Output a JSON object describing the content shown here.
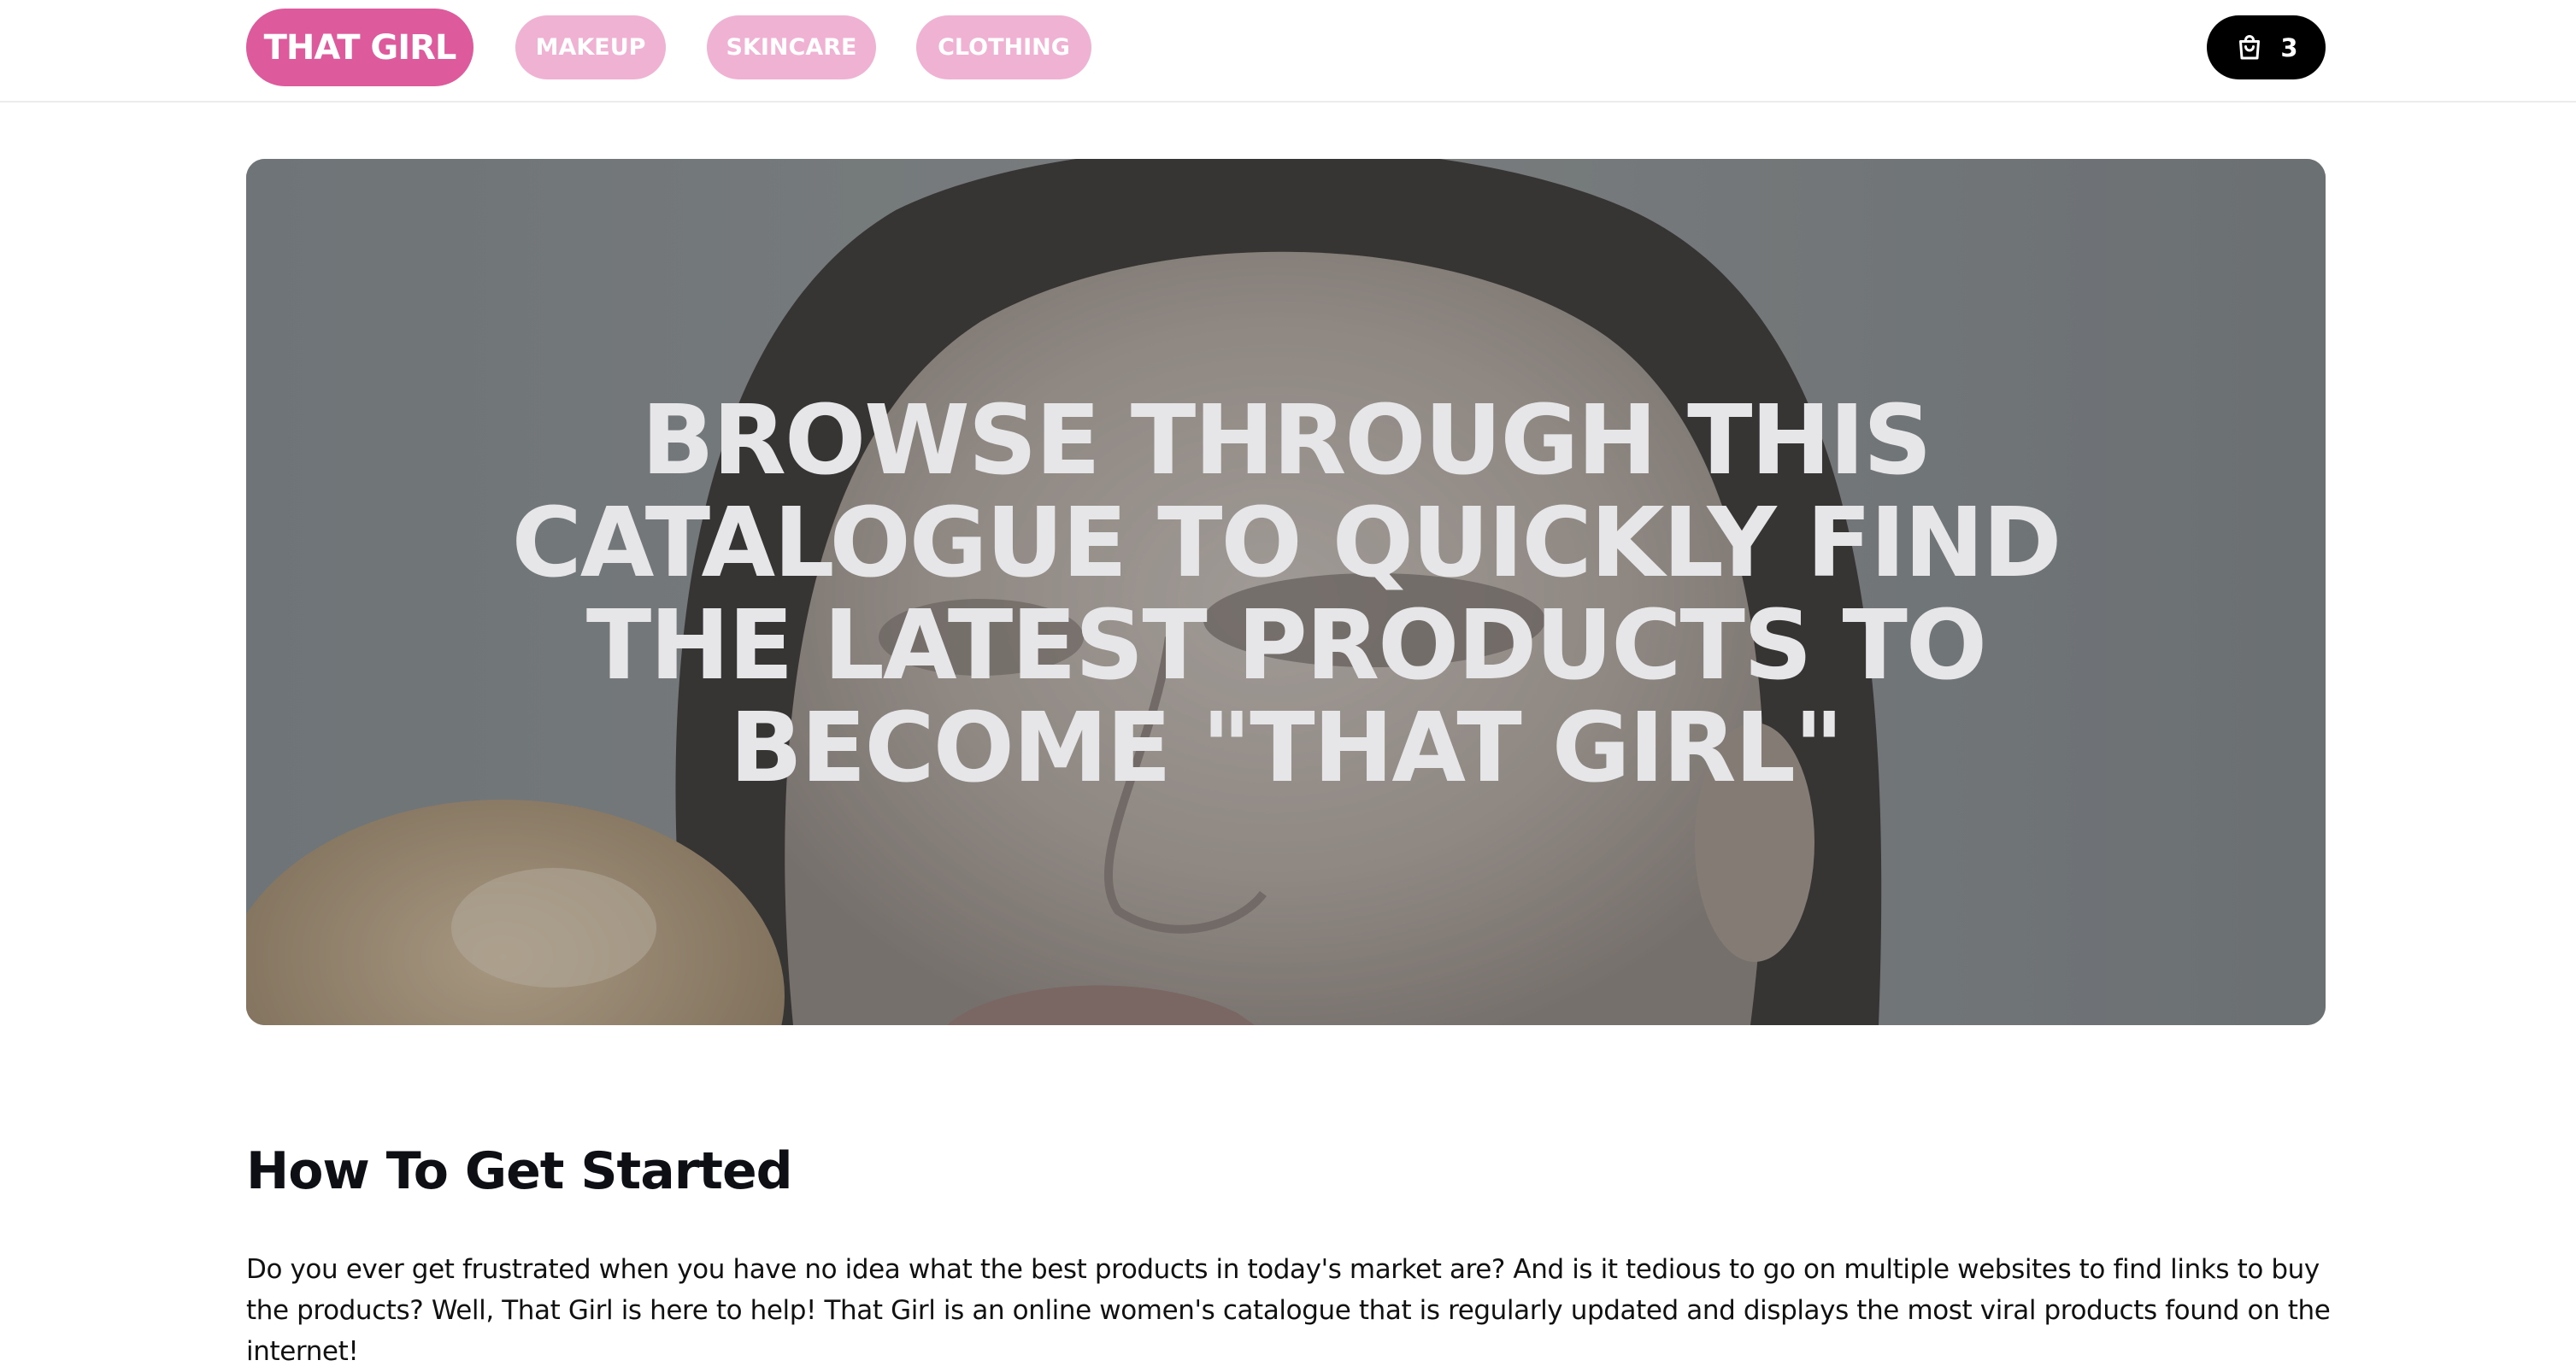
{
  "header": {
    "brand": "THAT GIRL",
    "nav": [
      {
        "label": "MAKEUP"
      },
      {
        "label": "SKINCARE"
      },
      {
        "label": "CLOTHING"
      }
    ],
    "cart": {
      "icon": "shopping-bag-icon",
      "count": "3"
    }
  },
  "hero": {
    "title": "BROWSE THROUGH THIS CATALOGUE TO QUICKLY FIND THE LATEST PRODUCTS TO BECOME \"THAT GIRL\""
  },
  "intro": {
    "heading": "How To Get Started",
    "body": "Do you ever get frustrated when you have no idea what the best products in today's market are? And is it tedious to go on multiple websites to find links to buy the products? Well, That Girl is here to help! That Girl is an online women's catalogue that is regularly updated and displays the most viral products found on the internet!"
  },
  "colors": {
    "brand": "#dd5a9d",
    "nav_pill": "#f0b2d3",
    "cart": "#000000",
    "hero_text": "#e6e6e8"
  }
}
